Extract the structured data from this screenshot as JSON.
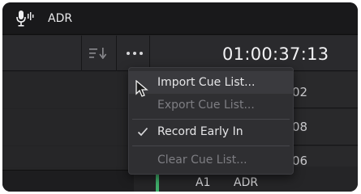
{
  "window": {
    "title": "ADR",
    "icon": "microphone-icon"
  },
  "toolbar": {
    "sort_icon": "sort-icon",
    "more_icon": "more-icon",
    "timecode": "01:00:37:13"
  },
  "rows": [
    {
      "code": "02"
    },
    {
      "code": "08"
    },
    {
      "code": "06"
    }
  ],
  "bottom": {
    "track_label": "A1",
    "track_name": "ADR",
    "marker_color": "#3fae6a"
  },
  "menu": {
    "items": [
      {
        "label": "Import Cue List...",
        "enabled": true,
        "checked": false,
        "hovered": true
      },
      {
        "label": "Export Cue List...",
        "enabled": false,
        "checked": false
      },
      {
        "label": "Record Early In",
        "enabled": true,
        "checked": true
      },
      {
        "label": "Clear Cue List...",
        "enabled": false,
        "checked": false
      }
    ]
  }
}
